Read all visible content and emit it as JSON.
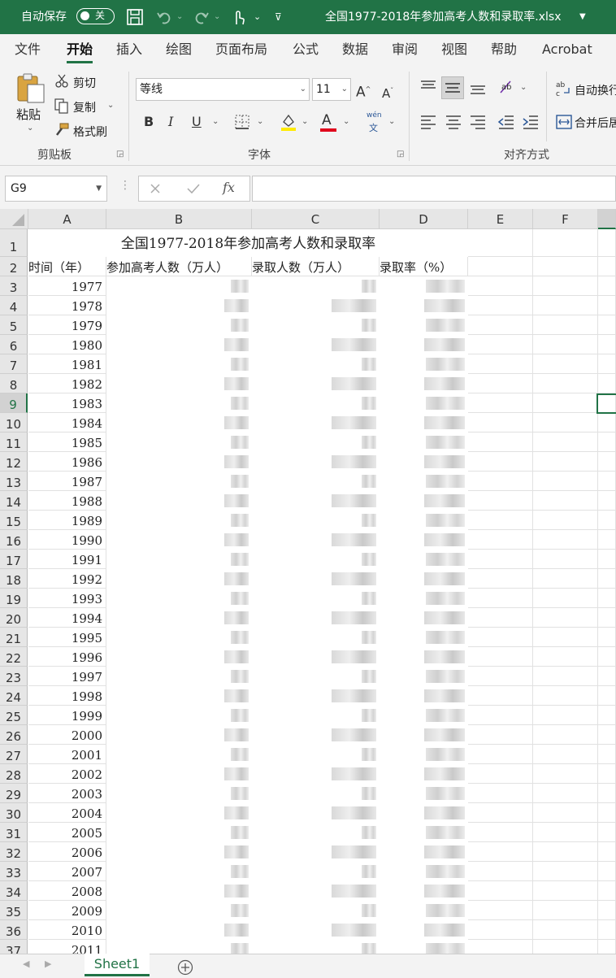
{
  "titlebar": {
    "autosave_label": "自动保存",
    "autosave_state": "关",
    "filename": "全国1977-2018年参加高考人数和录取率.xlsx"
  },
  "tabs": [
    "文件",
    "开始",
    "插入",
    "绘图",
    "页面布局",
    "公式",
    "数据",
    "审阅",
    "视图",
    "帮助",
    "Acrobat"
  ],
  "ribbon": {
    "clipboard": {
      "paste": "粘贴",
      "cut": "剪切",
      "copy": "复制",
      "format_painter": "格式刷",
      "group": "剪贴板"
    },
    "font": {
      "name": "等线",
      "size": "11",
      "group": "字体",
      "bold": "B",
      "italic": "I",
      "underline": "U",
      "phonetic_top": "wén",
      "phonetic_bottom": "文"
    },
    "alignment": {
      "wrap": "自动换行",
      "merge": "合并后居中",
      "group": "对齐方式"
    }
  },
  "formula_bar": {
    "name_box": "G9",
    "fx": "fx"
  },
  "columns": [
    "A",
    "B",
    "C",
    "D",
    "E",
    "F"
  ],
  "sheet": {
    "title": "全国1977-2018年参加高考人数和录取率",
    "headers": [
      "时间（年）",
      "参加高考人数（万人）",
      "录取人数（万人）",
      "录取率（%）"
    ],
    "rows": [
      "1",
      "2",
      "3",
      "4",
      "5",
      "6",
      "7",
      "8",
      "9",
      "10",
      "11",
      "12",
      "13",
      "14",
      "15",
      "16",
      "17",
      "18",
      "19",
      "20",
      "21",
      "22",
      "23",
      "24",
      "25",
      "26",
      "27",
      "28",
      "29",
      "30",
      "31",
      "32",
      "33",
      "34",
      "35",
      "36",
      "37"
    ],
    "years": [
      "1977",
      "1978",
      "1979",
      "1980",
      "1981",
      "1982",
      "1983",
      "1984",
      "1985",
      "1986",
      "1987",
      "1988",
      "1989",
      "1990",
      "1991",
      "1992",
      "1993",
      "1994",
      "1995",
      "1996",
      "1997",
      "1998",
      "1999",
      "2000",
      "2001",
      "2002",
      "2003",
      "2004",
      "2005",
      "2006",
      "2007",
      "2008",
      "2009",
      "2010",
      "2011"
    ]
  },
  "sheet_tabs": [
    "Sheet1"
  ]
}
